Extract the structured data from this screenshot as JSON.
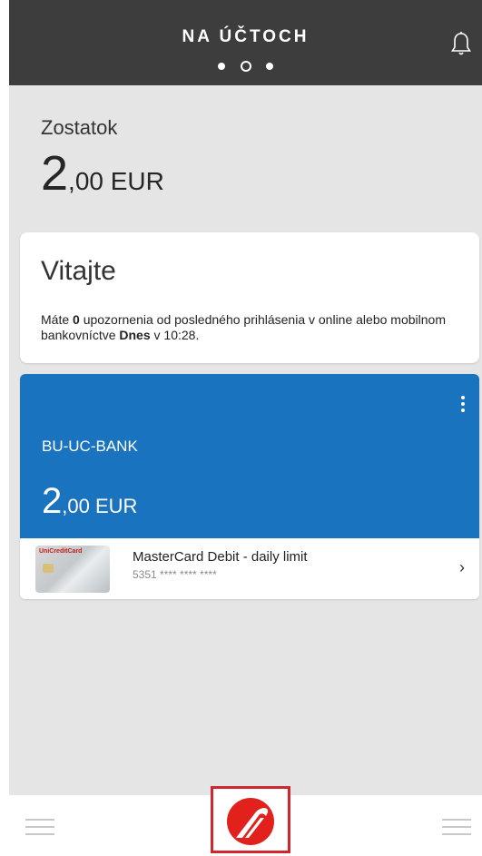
{
  "header": {
    "title": "NA ÚČTOCH",
    "page_count": 3,
    "active_page": 2
  },
  "balance": {
    "label": "Zostatok",
    "amount_int": "2",
    "amount_rest": ",00 EUR"
  },
  "welcome": {
    "title": "Vitajte",
    "text_before_count": "Máte ",
    "count": "0",
    "text_after_count": " upozornenia od posledného prihlásenia v online alebo mobilnom bankovníctve ",
    "when": "Dnes",
    "time_text": " v 10:28."
  },
  "account": {
    "name": "BU-UC-BANK",
    "amount_int": "2",
    "amount_rest": ",00 EUR",
    "card": {
      "brand": "UniCreditCard",
      "label": "MasterCard Debit - daily limit",
      "number": "5351 **** **** ****"
    }
  },
  "colors": {
    "header_bg": "#3d3d3d",
    "account_blue": "#1a73be",
    "brand_red": "#e2211c"
  },
  "icons": {
    "bell": "bell-icon",
    "menu": "hamburger-menu-icon",
    "more": "more-vertical-icon",
    "chevron": "chevron-right-icon",
    "logo": "unicredit-logo"
  }
}
